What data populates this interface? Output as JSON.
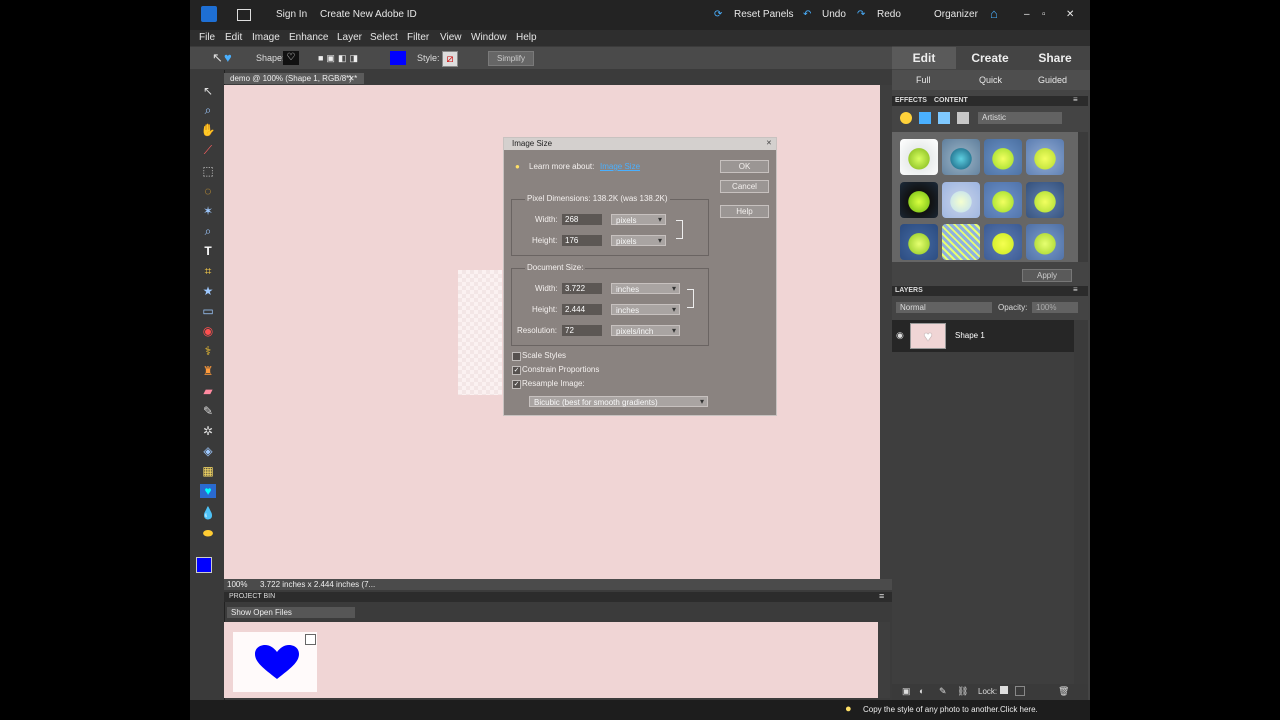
{
  "titlebar": {
    "sign_in": "Sign In",
    "create_id": "Create New Adobe ID",
    "reset_panels": "Reset Panels",
    "undo": "Undo",
    "redo": "Redo",
    "organizer": "Organizer"
  },
  "menu": [
    "File",
    "Edit",
    "Image",
    "Enhance",
    "Layer",
    "Select",
    "Filter",
    "View",
    "Window",
    "Help"
  ],
  "options_bar": {
    "shape_label": "Shape:",
    "style_label": "Style:",
    "simplify": "Simplify"
  },
  "document": {
    "tab_title": "demo @ 100% (Shape 1, RGB/8*) *",
    "zoom": "100%",
    "size_info": "3.722 inches x 2.444 inches (7..."
  },
  "dialog": {
    "title": "Image Size",
    "learn_more": "Learn more about:",
    "learn_link": "Image Size",
    "ok": "OK",
    "cancel": "Cancel",
    "help": "Help",
    "pixel_dimensions": "Pixel Dimensions: 138.2K (was 138.2K)",
    "width_label": "Width:",
    "height_label": "Height:",
    "pixel_width": "268",
    "pixel_height": "176",
    "pixel_unit": "pixels",
    "document_size": "Document Size:",
    "doc_width": "3.722",
    "doc_height": "2.444",
    "doc_unit": "inches",
    "resolution_label": "Resolution:",
    "resolution": "72",
    "resolution_unit": "pixels/inch",
    "scale_styles": "Scale Styles",
    "constrain": "Constrain Proportions",
    "resample": "Resample Image:",
    "resample_method": "Bicubic (best for smooth gradients)"
  },
  "project_bin": {
    "title": "PROJECT BIN",
    "show": "Show Open Files"
  },
  "right_panel": {
    "tabs": [
      "Edit",
      "Create",
      "Share"
    ],
    "subtabs": [
      "Full",
      "Quick",
      "Guided"
    ],
    "effects_tabs": [
      "EFFECTS",
      "CONTENT"
    ],
    "effects_filter": "Artistic",
    "apply": "Apply",
    "layers_title": "LAYERS",
    "blend_mode": "Normal",
    "opacity_label": "Opacity:",
    "opacity_value": "100%",
    "layer_name": "Shape 1",
    "lock_label": "Lock:"
  },
  "hint": "Copy the style of any photo to another.Click here.",
  "colors": {
    "foreground": "#0000ff",
    "heart": "#0000ff",
    "canvas": "#f0d5d5"
  }
}
